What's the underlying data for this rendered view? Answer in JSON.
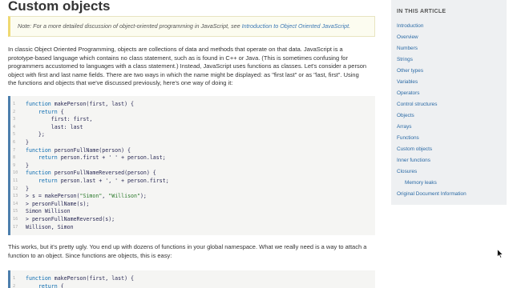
{
  "article": {
    "title": "Custom objects",
    "note": {
      "prefix": "Note: For a more detailed discussion of object-oriented programming in JavaScript, see ",
      "link": "Introduction to Object Oriented JavaScript",
      "suffix": "."
    },
    "paragraph1": [
      "In classic Object Oriented Programming, objects are collections of data and methods that operate on that data. JavaScript is a",
      "prototype-based language which contains no class statement, such as is found in C++ or Java. (This is sometimes confusing for",
      "programmers accustomed to languages with a class statement.) Instead, JavaScript uses functions as classes. Let's consider a person",
      "object with first and last name fields. There are two ways in which the name might be displayed: as \"first last\" or as \"last, first\". Using",
      "the functions and objects that we've discussed previously, here's one way of doing it:"
    ],
    "code1": [
      {
        "n": "1",
        "t": "function makePerson(first, last) {"
      },
      {
        "n": "2",
        "t": "    return {"
      },
      {
        "n": "3",
        "t": "        first: first,"
      },
      {
        "n": "4",
        "t": "        last: last"
      },
      {
        "n": "5",
        "t": "    };"
      },
      {
        "n": "6",
        "t": "}"
      },
      {
        "n": "7",
        "t": "function personFullName(person) {"
      },
      {
        "n": "8",
        "t": "    return person.first + ' ' + person.last;"
      },
      {
        "n": "9",
        "t": "}"
      },
      {
        "n": "10",
        "t": "function personFullNameReversed(person) {"
      },
      {
        "n": "11",
        "t": "    return person.last + ', ' + person.first;"
      },
      {
        "n": "12",
        "t": "}"
      },
      {
        "n": "13",
        "t": "> s = makePerson(\"Simon\", \"Willison\");"
      },
      {
        "n": "14",
        "t": "> personFullName(s);"
      },
      {
        "n": "15",
        "t": "Simon Willison"
      },
      {
        "n": "16",
        "t": "> personFullNameReversed(s);"
      },
      {
        "n": "17",
        "t": "Willison, Simon"
      }
    ],
    "paragraph2": [
      "This works, but it's pretty ugly. You end up with dozens of functions in your global namespace. What we really need is a way to attach a",
      "function to an object. Since functions are objects, this is easy:"
    ],
    "code2": [
      {
        "n": "1",
        "t": "function makePerson(first, last) {"
      },
      {
        "n": "2",
        "t": "    return {"
      }
    ]
  },
  "sidebar": {
    "heading": "IN THIS ARTICLE",
    "items": [
      {
        "label": "Introduction",
        "sub": false
      },
      {
        "label": "Overview",
        "sub": false
      },
      {
        "label": "Numbers",
        "sub": false
      },
      {
        "label": "Strings",
        "sub": false
      },
      {
        "label": "Other types",
        "sub": false
      },
      {
        "label": "Variables",
        "sub": false
      },
      {
        "label": "Operators",
        "sub": false
      },
      {
        "label": "Control structures",
        "sub": false
      },
      {
        "label": "Objects",
        "sub": false
      },
      {
        "label": "Arrays",
        "sub": false
      },
      {
        "label": "Functions",
        "sub": false
      },
      {
        "label": "Custom objects",
        "sub": false
      },
      {
        "label": "Inner functions",
        "sub": false
      },
      {
        "label": "Closures",
        "sub": false
      },
      {
        "label": "Memory leaks",
        "sub": true
      },
      {
        "label": "Original Document Information",
        "sub": false
      }
    ]
  },
  "colors": {
    "link": "#2b6aa5",
    "code_border": "#4d7fad",
    "note_border": "#efd971",
    "sidebar_bg": "#eef0f2"
  }
}
